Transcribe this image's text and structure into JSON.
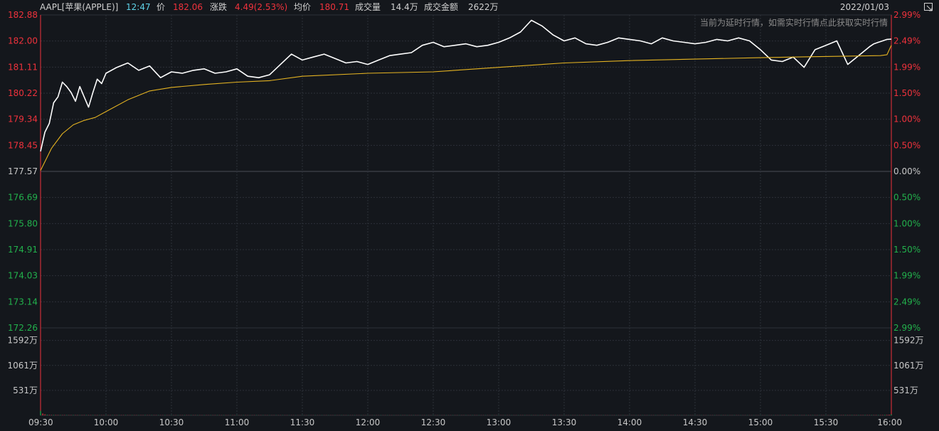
{
  "header": {
    "symbol": "AAPL[苹果(APPLE)]",
    "time": "12:47",
    "price_label": "价",
    "price": "182.06",
    "change_label": "涨跌",
    "change": "4.49(2.53%)",
    "avg_label": "均价",
    "avg": "180.71",
    "volume_label": "成交量",
    "volume": "14.4万",
    "amount_label": "成交金额",
    "amount": "2622万",
    "date": "2022/01/03",
    "notice": "当前为延时行情，如需实时行情点此获取实时行情"
  },
  "colors": {
    "background": "#14171c",
    "grid": "#2c3038",
    "price_line": "#ffffff",
    "avg_line": "#e6b422",
    "up": "#f0323c",
    "down": "#22b14c",
    "neutral": "#c8c8c8"
  },
  "chart_data": {
    "type": "line",
    "title": "",
    "prev_close": 177.57,
    "ylim": [
      172.26,
      182.88
    ],
    "y_ticks_left": [
      "182.88",
      "182.00",
      "181.11",
      "180.22",
      "179.34",
      "178.45",
      "177.57",
      "176.69",
      "175.80",
      "174.91",
      "174.03",
      "173.14",
      "172.26"
    ],
    "y_ticks_right": [
      "2.99%",
      "2.49%",
      "1.99%",
      "1.50%",
      "1.00%",
      "0.50%",
      "0.00%",
      "0.50%",
      "1.00%",
      "1.50%",
      "1.99%",
      "2.49%",
      "2.99%"
    ],
    "x_ticks": [
      "09:30",
      "10:00",
      "10:30",
      "11:00",
      "11:30",
      "12:00",
      "12:30",
      "13:00",
      "13:30",
      "14:00",
      "14:30",
      "15:00",
      "15:30",
      "16:00"
    ],
    "volume_ticks": [
      "1592万",
      "1061万",
      "531万"
    ],
    "volume_ylim": [
      0,
      1858
    ],
    "series": [
      {
        "key": "price",
        "x_minutes": [
          0,
          2,
          4,
          6,
          8,
          10,
          12,
          14,
          16,
          18,
          20,
          22,
          24,
          26,
          28,
          30,
          35,
          40,
          45,
          50,
          55,
          60,
          65,
          70,
          75,
          80,
          85,
          90,
          95,
          100,
          105,
          110,
          115,
          120,
          125,
          130,
          135,
          140,
          145,
          150,
          155,
          160,
          165,
          170,
          175,
          180,
          185,
          190,
          195,
          200,
          205,
          210,
          215,
          220,
          225,
          230,
          235,
          240,
          245,
          250,
          255,
          260,
          265,
          270,
          275,
          280,
          285,
          290,
          295,
          300,
          305,
          310,
          315,
          320,
          325,
          330,
          335,
          340,
          345,
          350,
          355,
          360,
          365,
          370,
          375,
          380,
          382,
          384,
          386,
          388,
          390
        ],
        "values": [
          178.25,
          178.9,
          179.2,
          179.9,
          180.1,
          180.6,
          180.45,
          180.25,
          179.95,
          180.45,
          180.1,
          179.75,
          180.25,
          180.7,
          180.55,
          180.9,
          181.1,
          181.25,
          181.0,
          181.15,
          180.75,
          180.95,
          180.9,
          181.0,
          181.05,
          180.9,
          180.95,
          181.05,
          180.8,
          180.75,
          180.85,
          181.2,
          181.55,
          181.35,
          181.45,
          181.55,
          181.4,
          181.25,
          181.3,
          181.2,
          181.35,
          181.5,
          181.55,
          181.6,
          181.85,
          181.95,
          181.8,
          181.85,
          181.9,
          181.8,
          181.85,
          181.95,
          182.1,
          182.3,
          182.7,
          182.5,
          182.2,
          182.0,
          182.1,
          181.9,
          181.85,
          181.95,
          182.1,
          182.05,
          182.0,
          181.9,
          182.1,
          182.0,
          181.95,
          181.9,
          181.95,
          182.05,
          182.0,
          182.1,
          182.0,
          181.7,
          181.35,
          181.3,
          181.45,
          181.1,
          181.7,
          181.85,
          182.0,
          181.2,
          181.5,
          181.8,
          181.9,
          181.95,
          182.0,
          182.05,
          182.06
        ]
      },
      {
        "key": "average",
        "x_minutes": [
          0,
          5,
          10,
          15,
          20,
          25,
          30,
          40,
          50,
          60,
          75,
          90,
          105,
          120,
          150,
          180,
          210,
          240,
          270,
          300,
          330,
          360,
          385,
          388,
          390
        ],
        "values": [
          177.6,
          178.35,
          178.85,
          179.15,
          179.3,
          179.4,
          179.6,
          180.0,
          180.3,
          180.42,
          180.52,
          180.6,
          180.65,
          180.8,
          180.9,
          180.95,
          181.1,
          181.25,
          181.33,
          181.38,
          181.43,
          181.47,
          181.5,
          181.53,
          181.85
        ]
      }
    ],
    "volume": {
      "x_minutes": [
        0,
        1,
        2,
        3,
        4,
        5,
        10,
        20,
        30,
        60,
        90,
        120,
        150,
        180,
        210,
        240,
        270,
        300,
        330,
        360,
        385,
        388,
        390
      ],
      "values": [
        95,
        40,
        22,
        12,
        10,
        8,
        6,
        5,
        5,
        4,
        4,
        3,
        3,
        3,
        3,
        3,
        3,
        3,
        3,
        4,
        6,
        10,
        18
      ]
    }
  }
}
